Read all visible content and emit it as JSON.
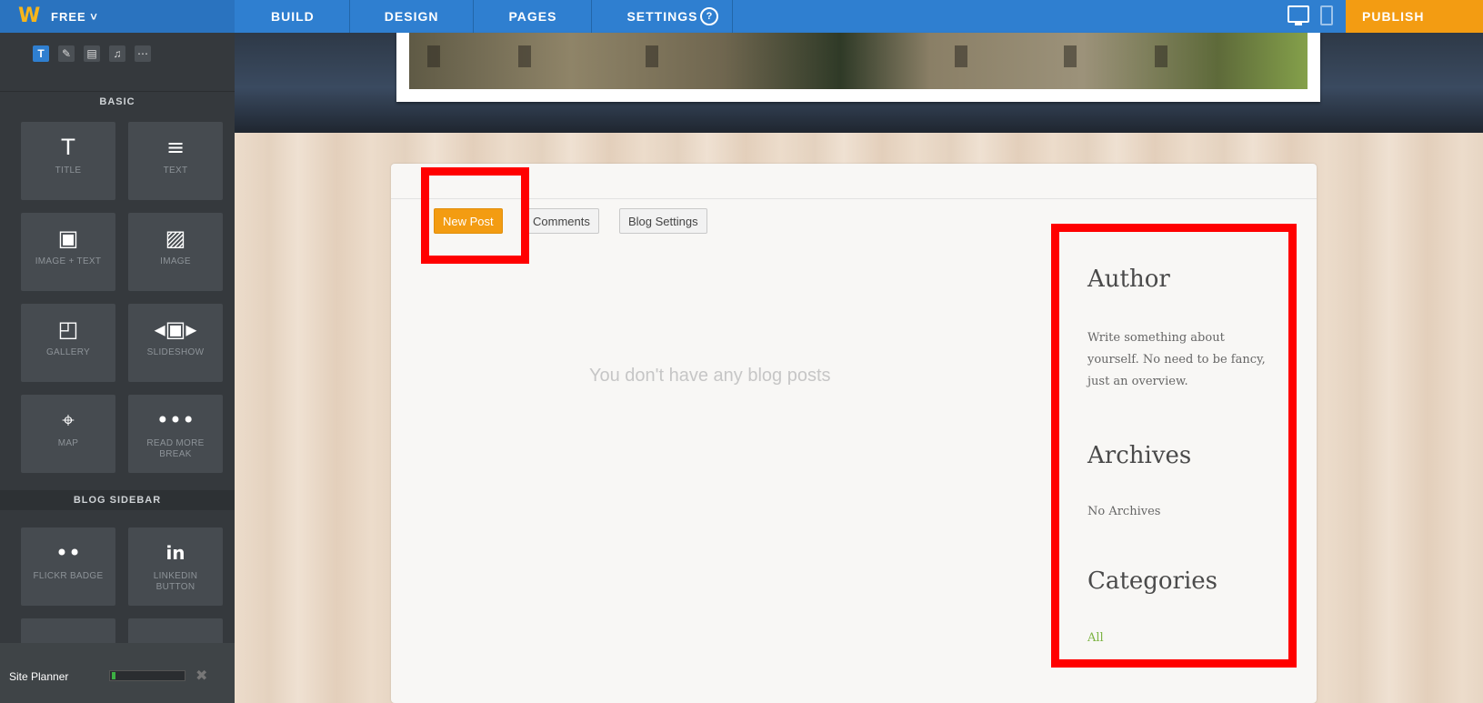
{
  "topbar": {
    "logo": "W",
    "plan": "FREE",
    "nav": [
      "BUILD",
      "DESIGN",
      "PAGES",
      "SETTINGS"
    ],
    "help": "?",
    "publish": "PUBLISH"
  },
  "sidebar": {
    "basic_label": "BASIC",
    "basic_tiles": [
      {
        "label": "TITLE",
        "icon": "T"
      },
      {
        "label": "TEXT",
        "icon": "≡"
      },
      {
        "label": "IMAGE + TEXT",
        "icon": "▣"
      },
      {
        "label": "IMAGE",
        "icon": "▨"
      },
      {
        "label": "GALLERY",
        "icon": "◰"
      },
      {
        "label": "SLIDESHOW",
        "icon": "◂▣▸"
      },
      {
        "label": "MAP",
        "icon": "⌖"
      },
      {
        "label": "READ MORE BREAK",
        "icon": "•••"
      }
    ],
    "blog_label": "BLOG SIDEBAR",
    "blog_tiles": [
      {
        "label": "FLICKR BADGE",
        "icon": "••"
      },
      {
        "label": "LINKEDIN BUTTON",
        "icon": "in"
      }
    ],
    "site_planner": "Site Planner"
  },
  "blog": {
    "buttons": {
      "new_post": "New Post",
      "comments": "Comments",
      "settings": "Blog Settings"
    },
    "empty_message": "You don't have any blog posts"
  },
  "side": {
    "author_title": "Author",
    "author_text": "Write something about yourself. No need to be fancy, just an overview.",
    "archives_title": "Archives",
    "archives_text": "No Archives",
    "categories_title": "Categories",
    "categories_link": "All"
  },
  "colors": {
    "accent": "#f39c12",
    "nav": "#2f7fd0",
    "highlight": "#ff0000"
  }
}
